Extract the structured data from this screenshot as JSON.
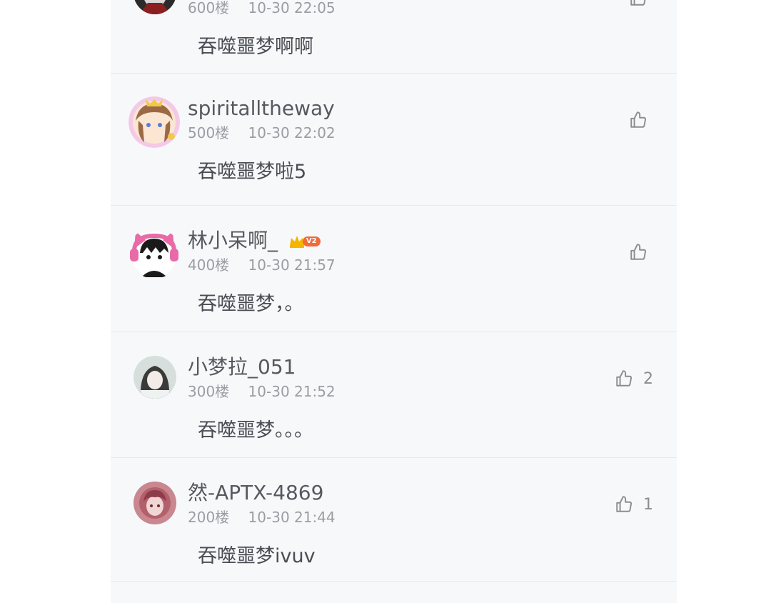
{
  "comments": [
    {
      "username": "",
      "floor": "600楼",
      "time": "10-30 22:05",
      "content": "吞噬噩梦啊啊",
      "likes": ""
    },
    {
      "username": "spiritalltheway",
      "floor": "500楼",
      "time": "10-30 22:02",
      "content": "吞噬噩梦啦5",
      "likes": ""
    },
    {
      "username": "林小呆啊_",
      "vip_level": "V2",
      "floor": "400楼",
      "time": "10-30 21:57",
      "content": "吞噬噩梦，。",
      "likes": ""
    },
    {
      "username": "小梦拉_051",
      "floor": "300楼",
      "time": "10-30 21:52",
      "content": "吞噬噩梦。。。",
      "likes": "2"
    },
    {
      "username": "然-APTX-4869",
      "floor": "200楼",
      "time": "10-30 21:44",
      "content": "吞噬噩梦ivuv",
      "likes": "1"
    }
  ],
  "icons": {
    "like": "thumbs-up-icon",
    "vip": "crown-icon"
  },
  "colors": {
    "panel_background": "#f7f8fa",
    "username": "#555a60",
    "meta": "#9a9da3",
    "vip_badge": "#ef6b3a"
  }
}
